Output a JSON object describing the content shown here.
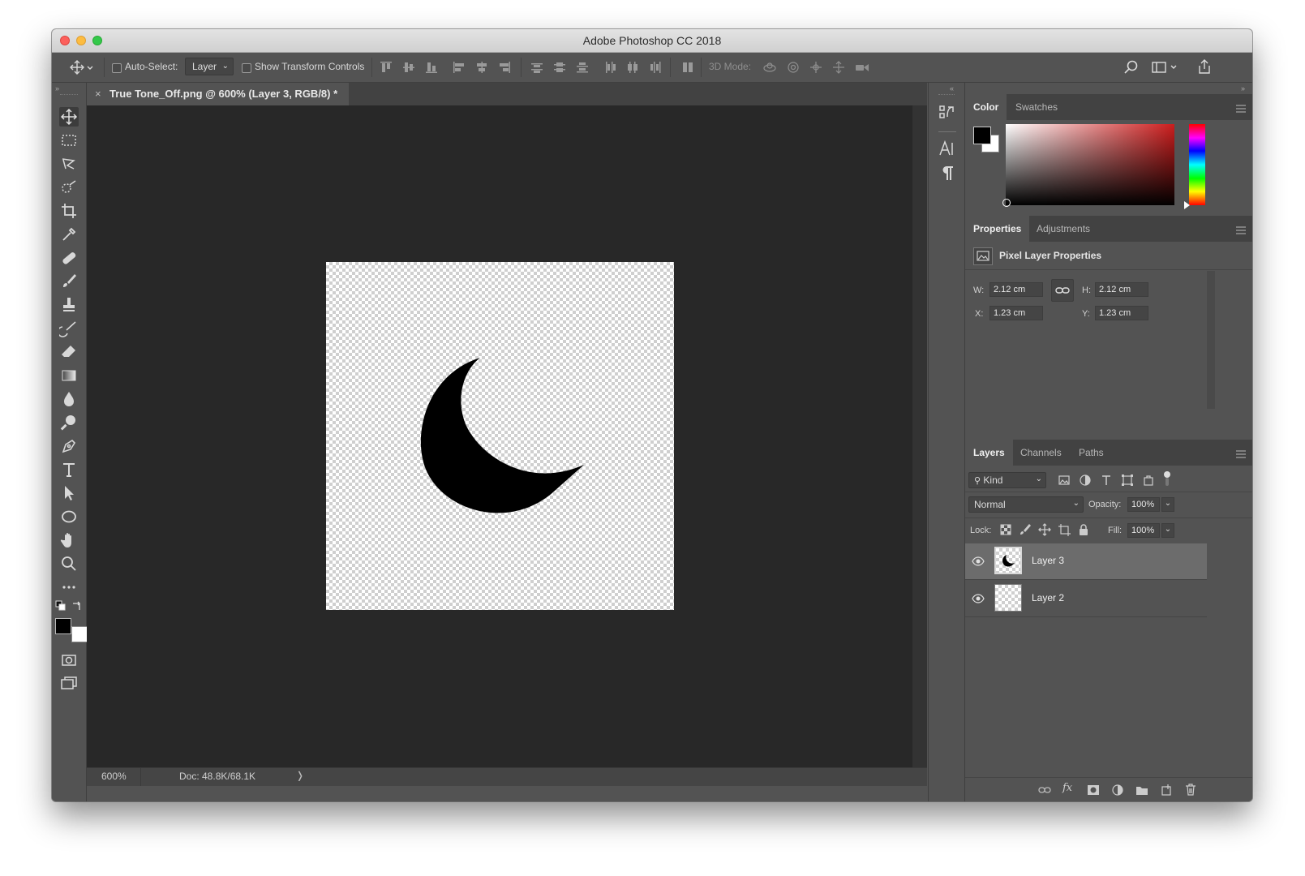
{
  "window": {
    "title": "Adobe Photoshop CC 2018"
  },
  "options_bar": {
    "auto_select_label": "Auto-Select:",
    "auto_select_target": "Layer",
    "show_transform_label": "Show Transform Controls",
    "mode_3d_label": "3D Mode:"
  },
  "document": {
    "tab_title": "True Tone_Off.png @ 600% (Layer 3, RGB/8) *",
    "zoom": "600%",
    "doc_info": "Doc: 48.8K/68.1K"
  },
  "tools": [
    "move-tool",
    "marquee-tool",
    "lasso-tool",
    "quick-selection-tool",
    "crop-tool",
    "eyedropper-tool",
    "healing-brush-tool",
    "brush-tool",
    "clone-stamp-tool",
    "history-brush-tool",
    "eraser-tool",
    "gradient-tool",
    "blur-tool",
    "dodge-tool",
    "pen-tool",
    "type-tool",
    "path-selection-tool",
    "ellipse-tool",
    "hand-tool",
    "zoom-tool",
    "more-tools"
  ],
  "colors": {
    "foreground": "#000000",
    "background": "#ffffff",
    "window_bg": "#535353",
    "canvas_bg": "#282828"
  },
  "color_panel": {
    "tabs": [
      "Color",
      "Swatches"
    ]
  },
  "properties_panel": {
    "tabs": [
      "Properties",
      "Adjustments"
    ],
    "header": "Pixel Layer Properties",
    "w_label": "W:",
    "w_value": "2.12 cm",
    "h_label": "H:",
    "h_value": "2.12 cm",
    "x_label": "X:",
    "x_value": "1.23 cm",
    "y_label": "Y:",
    "y_value": "1.23 cm"
  },
  "layers_panel": {
    "tabs": [
      "Layers",
      "Channels",
      "Paths"
    ],
    "filter_kind": "Kind",
    "blend_mode": "Normal",
    "opacity_label": "Opacity:",
    "opacity_value": "100%",
    "lock_label": "Lock:",
    "fill_label": "Fill:",
    "fill_value": "100%",
    "layers": [
      {
        "name": "Layer 3",
        "selected": true
      },
      {
        "name": "Layer 2",
        "selected": false
      }
    ]
  }
}
